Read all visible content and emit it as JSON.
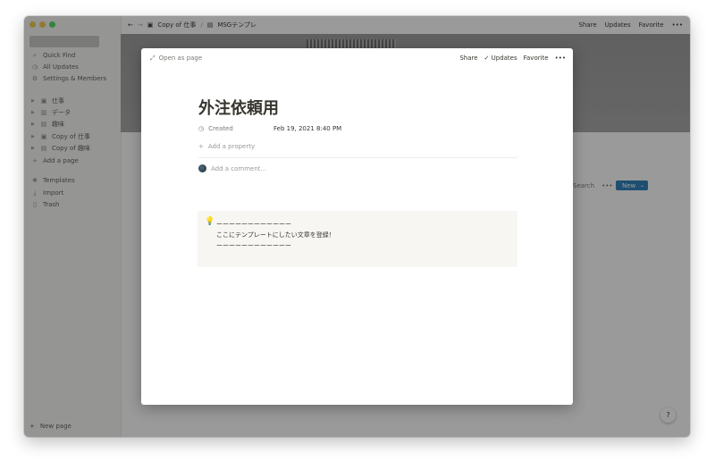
{
  "sidebar": {
    "nav": [
      {
        "icon": "search-icon",
        "glyph": "⌕",
        "label": "Quick Find"
      },
      {
        "icon": "clock-icon",
        "glyph": "◷",
        "label": "All Updates"
      },
      {
        "icon": "gear-icon",
        "glyph": "⚙",
        "label": "Settings & Members"
      }
    ],
    "pages": [
      {
        "icon": "briefcase-icon",
        "glyph": "▣",
        "label": "仕事"
      },
      {
        "icon": "chart-icon",
        "glyph": "▥",
        "label": "データ"
      },
      {
        "icon": "book-icon",
        "glyph": "▤",
        "label": "趣味"
      },
      {
        "icon": "briefcase-icon",
        "glyph": "▣",
        "label": "Copy of 仕事"
      },
      {
        "icon": "book-icon",
        "glyph": "▤",
        "label": "Copy of 趣味"
      }
    ],
    "add_page": "Add a page",
    "tools": [
      {
        "icon": "templates-icon",
        "glyph": "❖",
        "label": "Templates"
      },
      {
        "icon": "import-icon",
        "glyph": "⤓",
        "label": "Import"
      },
      {
        "icon": "trash-icon",
        "glyph": "🗑",
        "label": "Trash"
      }
    ],
    "new_page": "New page"
  },
  "topbar": {
    "crumb1": "Copy of 仕事",
    "crumb2": "MSGテンプレ",
    "share": "Share",
    "updates": "Updates",
    "favorite": "Favorite"
  },
  "background": {
    "search": "Search",
    "new": "New"
  },
  "modal": {
    "open_as_page": "Open as page",
    "share": "Share",
    "updates": "Updates",
    "favorite": "Favorite",
    "title": "外注依頼用",
    "prop_name": "Created",
    "prop_value": "Feb 19, 2021 8:40 PM",
    "add_property": "Add a property",
    "comment_placeholder": "Add a comment...",
    "callout": [
      "ーーーーーーーーーーーー",
      "ここにテンプレートにしたい文章を登録！",
      "ーーーーーーーーーーーー"
    ]
  },
  "help": "?"
}
